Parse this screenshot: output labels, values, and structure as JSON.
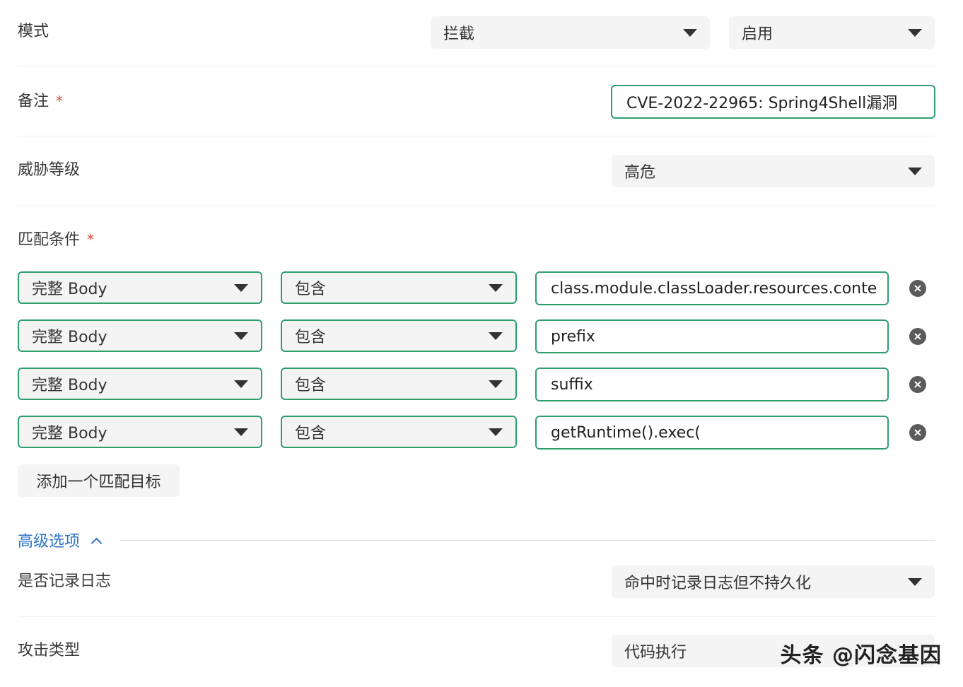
{
  "mode": {
    "label": "模式",
    "action_value": "拦截",
    "status_value": "启用"
  },
  "remark": {
    "label": "备注",
    "required_mark": "*",
    "value": "CVE-2022-22965: Spring4Shell漏洞"
  },
  "threat_level": {
    "label": "威胁等级",
    "value": "高危"
  },
  "match": {
    "label": "匹配条件",
    "required_mark": "*",
    "conditions": [
      {
        "target": "完整 Body",
        "operator": "包含",
        "value": "class.module.classLoader.resources.conte"
      },
      {
        "target": "完整 Body",
        "operator": "包含",
        "value": "prefix"
      },
      {
        "target": "完整 Body",
        "operator": "包含",
        "value": "suffix"
      },
      {
        "target": "完整 Body",
        "operator": "包含",
        "value": "getRuntime().exec("
      }
    ],
    "add_label": "添加一个匹配目标",
    "remove_icon": "close-circle-icon"
  },
  "advanced": {
    "label": "高级选项",
    "icon": "chevron-up-icon"
  },
  "log": {
    "label": "是否记录日志",
    "value": "命中时记录日志但不持久化"
  },
  "attack_type": {
    "label": "攻击类型",
    "value": "代码执行"
  },
  "watermark": "头条 @闪念基因",
  "colors": {
    "accent_border": "#2f9e6e",
    "link": "#2a73c8",
    "required": "#e0452f"
  }
}
